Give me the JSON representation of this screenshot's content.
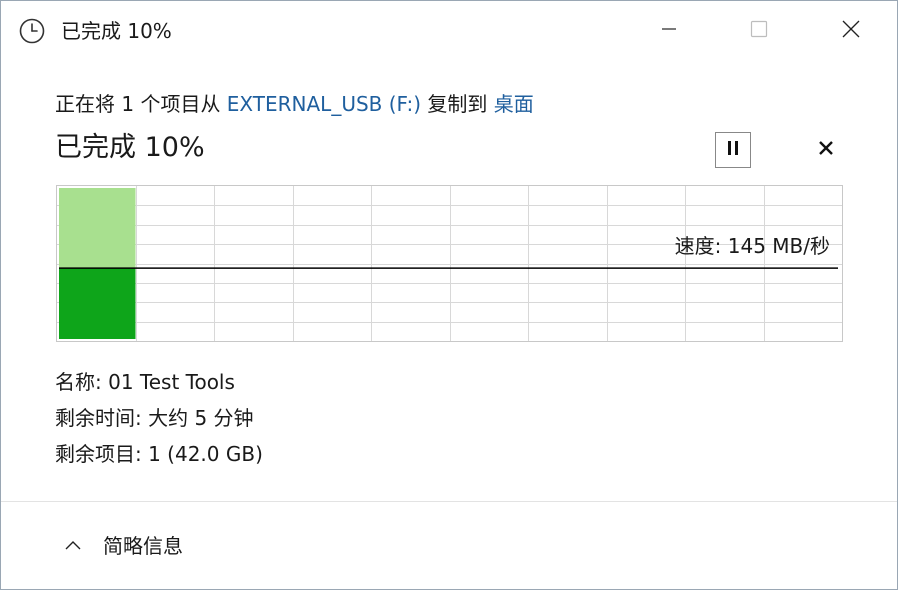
{
  "window": {
    "title": "已完成 10%",
    "icons": {
      "app": "clock-icon",
      "minimize": "minimize-icon",
      "maximize": "maximize-icon",
      "close": "close-icon"
    }
  },
  "header": {
    "copy_prefix": "正在将 1 个项目从 ",
    "source": "EXTERNAL_USB (F:)",
    "copy_middle": " 复制到 ",
    "destination": "桌面",
    "status": "已完成 10%"
  },
  "controls": {
    "pause_icon": "pause-icon",
    "cancel_icon": "cancel-icon"
  },
  "progress": {
    "percent": 10,
    "speed_label": "速度: 145 MB/秒",
    "colors": {
      "done_fill": "#a8e08f",
      "speed_fill": "#0ea51a",
      "grid": "#d8d8d8",
      "speed_line": "#000000",
      "link": "#1f5f9e"
    }
  },
  "details": {
    "name": "名称: 01 Test Tools",
    "time_remaining": "剩余时间: 大约 5 分钟",
    "items_remaining": "剩余项目: 1 (42.0 GB)"
  },
  "footer": {
    "toggle_label": "简略信息",
    "toggle_icon": "chevron-up-icon"
  }
}
